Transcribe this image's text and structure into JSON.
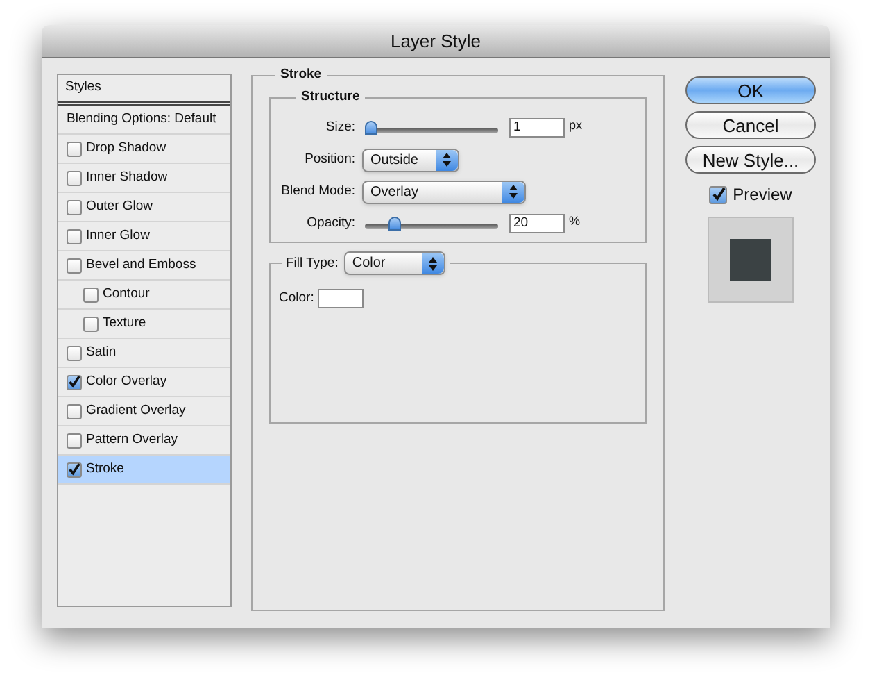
{
  "window": {
    "title": "Layer Style"
  },
  "styles_panel": {
    "header": "Styles",
    "items": [
      {
        "kind": "plain",
        "label": "Blending Options: Default",
        "selected": false
      },
      {
        "kind": "effect",
        "label": "Drop Shadow",
        "checked": false,
        "selected": false
      },
      {
        "kind": "effect",
        "label": "Inner Shadow",
        "checked": false,
        "selected": false
      },
      {
        "kind": "effect",
        "label": "Outer Glow",
        "checked": false,
        "selected": false
      },
      {
        "kind": "effect",
        "label": "Inner Glow",
        "checked": false,
        "selected": false
      },
      {
        "kind": "effect",
        "label": "Bevel and Emboss",
        "checked": false,
        "selected": false,
        "children": [
          {
            "kind": "effect",
            "label": "Contour",
            "checked": false,
            "selected": false
          },
          {
            "kind": "effect",
            "label": "Texture",
            "checked": false,
            "selected": false
          }
        ]
      },
      {
        "kind": "effect",
        "label": "Satin",
        "checked": false,
        "selected": false
      },
      {
        "kind": "effect",
        "label": "Color Overlay",
        "checked": true,
        "selected": false
      },
      {
        "kind": "effect",
        "label": "Gradient Overlay",
        "checked": false,
        "selected": false
      },
      {
        "kind": "effect",
        "label": "Pattern Overlay",
        "checked": false,
        "selected": false
      },
      {
        "kind": "effect",
        "label": "Stroke",
        "checked": true,
        "selected": true
      }
    ]
  },
  "stroke": {
    "title": "Stroke",
    "structure": {
      "title": "Structure",
      "rows": [
        {
          "kind": "slider",
          "label": "Size:",
          "level": 0.0,
          "value": "1",
          "unit": "px"
        },
        {
          "kind": "select",
          "label": "Position:",
          "value": "Outside"
        },
        {
          "kind": "select",
          "label": "Blend Mode:",
          "value": "Overlay"
        },
        {
          "kind": "slider",
          "label": "Opacity:",
          "level": 0.2,
          "value": "20",
          "unit": "%"
        }
      ]
    },
    "fill": {
      "label": "Fill Type:",
      "value": "Color",
      "color_label": "Color:",
      "color": "#ffffff"
    }
  },
  "buttons": [
    {
      "label": "OK",
      "default": true
    },
    {
      "label": "Cancel",
      "default": false
    },
    {
      "label": "New Style...",
      "default": false
    }
  ],
  "preview": {
    "label": "Preview",
    "checked": true
  }
}
